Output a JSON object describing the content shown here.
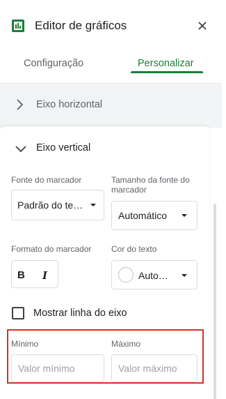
{
  "header": {
    "title": "Editor de gráficos",
    "icon": "chart-icon",
    "close_icon": "close-icon"
  },
  "tabs": [
    {
      "label": "Configuração",
      "active": false
    },
    {
      "label": "Personalizar",
      "active": true
    }
  ],
  "sections": {
    "horizontal": {
      "label": "Eixo horizontal",
      "expanded": false
    },
    "vertical": {
      "label": "Eixo vertical",
      "expanded": true
    }
  },
  "fields": {
    "font_label": "Fonte do marcador",
    "font_value": "Padrão do te…",
    "size_label": "Tamanho da fonte do marcador",
    "size_value": "Automático",
    "format_label": "Formato do marcador",
    "bold_label": "B",
    "italic_label": "I",
    "color_label": "Cor do texto",
    "color_value": "Auto…",
    "show_axis_line_label": "Mostrar linha do eixo",
    "min_label": "Mínimo",
    "min_placeholder": "Valor mínimo",
    "max_label": "Máximo",
    "max_placeholder": "Valor máximo"
  },
  "colors": {
    "accent": "#188038",
    "highlight": "#d93025",
    "icon_green": "#188038"
  }
}
